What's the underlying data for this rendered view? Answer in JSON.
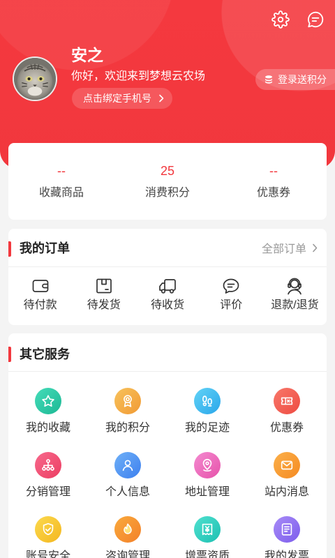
{
  "colors": {
    "primary": "#f2383e",
    "title_text": "#222222",
    "body_text": "#333333",
    "muted_text": "#999999",
    "page_bg": "#f4f4f4"
  },
  "header": {
    "settings_icon": "gear-icon",
    "message_icon": "message-icon",
    "avatar_icon": "cat-avatar",
    "user_name": "安之",
    "greeting": "你好，欢迎来到梦想云农场",
    "bind_phone_label": "点击绑定手机号",
    "login_points_icon": "coin-stack-icon",
    "login_points_label": "登录送积分"
  },
  "stats": [
    {
      "value": "--",
      "label": "收藏商品"
    },
    {
      "value": "25",
      "label": "消费积分"
    },
    {
      "value": "--",
      "label": "优惠券"
    }
  ],
  "orders": {
    "title": "我的订单",
    "all_label": "全部订单",
    "items": [
      {
        "label": "待付款",
        "icon": "wallet-icon"
      },
      {
        "label": "待发货",
        "icon": "package-icon"
      },
      {
        "label": "待收货",
        "icon": "truck-icon"
      },
      {
        "label": "评价",
        "icon": "comment-icon"
      },
      {
        "label": "退款/退货",
        "icon": "customer-service-icon"
      }
    ]
  },
  "services": {
    "title": "其它服务",
    "items": [
      {
        "label": "我的收藏",
        "icon": "star-icon",
        "colors": [
          "#45dcb9",
          "#1cb894"
        ]
      },
      {
        "label": "我的积分",
        "icon": "medal-icon",
        "colors": [
          "#f7c25c",
          "#f19a34"
        ]
      },
      {
        "label": "我的足迹",
        "icon": "footprint-icon",
        "colors": [
          "#62d3f6",
          "#2aa6ea"
        ]
      },
      {
        "label": "优惠券",
        "icon": "coupon-icon",
        "colors": [
          "#f8786a",
          "#ee4b42"
        ]
      },
      {
        "label": "分销管理",
        "icon": "network-icon",
        "colors": [
          "#f7698c",
          "#ec3d62"
        ]
      },
      {
        "label": "个人信息",
        "icon": "person-icon",
        "colors": [
          "#6fb0f7",
          "#3d80ef"
        ]
      },
      {
        "label": "地址管理",
        "icon": "location-pin-icon",
        "colors": [
          "#f48ad0",
          "#e653aa"
        ]
      },
      {
        "label": "站内消息",
        "icon": "envelope-icon",
        "colors": [
          "#fbb04a",
          "#f58a22"
        ]
      },
      {
        "label": "账号安全",
        "icon": "shield-check-icon",
        "colors": [
          "#fbd94e",
          "#f4b71f"
        ]
      },
      {
        "label": "咨询管理",
        "icon": "flame-icon",
        "colors": [
          "#f9a93c",
          "#f3812a"
        ]
      },
      {
        "label": "增票资质",
        "icon": "receipt-yen-icon",
        "colors": [
          "#4fe0cf",
          "#1ec0b2"
        ]
      },
      {
        "label": "我的发票",
        "icon": "invoice-document-icon",
        "colors": [
          "#a88cf7",
          "#7c5cec"
        ]
      }
    ]
  }
}
